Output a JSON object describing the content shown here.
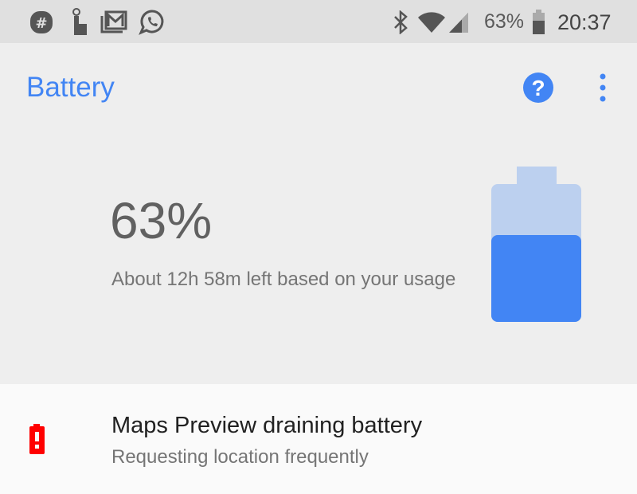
{
  "status_bar": {
    "notification_icons": [
      "slack-icon",
      "touch-icon",
      "gmail-icon",
      "whatsapp-icon"
    ],
    "system_icons": [
      "bluetooth-icon",
      "wifi-icon",
      "cell-signal-icon"
    ],
    "battery_percent": "63%",
    "time": "20:37"
  },
  "app_bar": {
    "title": "Battery",
    "help_icon": "help-icon",
    "menu_icon": "more-vert-icon"
  },
  "summary": {
    "percent": "63%",
    "level": 0.63,
    "estimate": "About 12h 58m left based on your usage",
    "accent": "#4285f4",
    "empty_color": "#bcd0ef"
  },
  "tip": {
    "icon": "battery-alert-icon",
    "icon_color": "#ff0000",
    "title": "Maps Preview draining battery",
    "subtitle": "Requesting location frequently"
  }
}
